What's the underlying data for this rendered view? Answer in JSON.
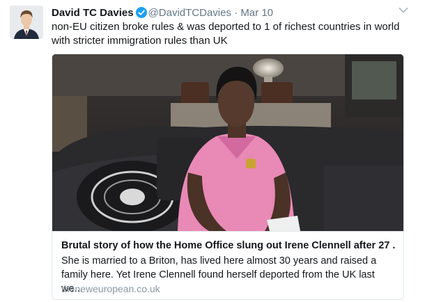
{
  "tweet": {
    "display_name": "David TC Davies",
    "handle": "@DavidTCDavies",
    "separator": "·",
    "timestamp": "Mar 10",
    "text": "non-EU citizen broke rules & was deported to 1 of richest countries in world with stricter immigration rules than UK"
  },
  "card": {
    "title": "Brutal story of how the Home Office slung out Irene Clennell after 27 ...",
    "description": "She is married to a Briton, has lived here almost 30 years and raised a family here. Yet Irene Clennell found herself deported from the UK last we...",
    "domain": "theneweuropean.co.uk"
  },
  "colors": {
    "text": "#14171a",
    "secondary": "#657786",
    "verified_badge": "#1da1f2",
    "card_border": "#e1e8ed",
    "domain": "#8899a6"
  },
  "icons": {
    "verified": "verified-badge-icon",
    "menu": "chevron-down-icon"
  }
}
